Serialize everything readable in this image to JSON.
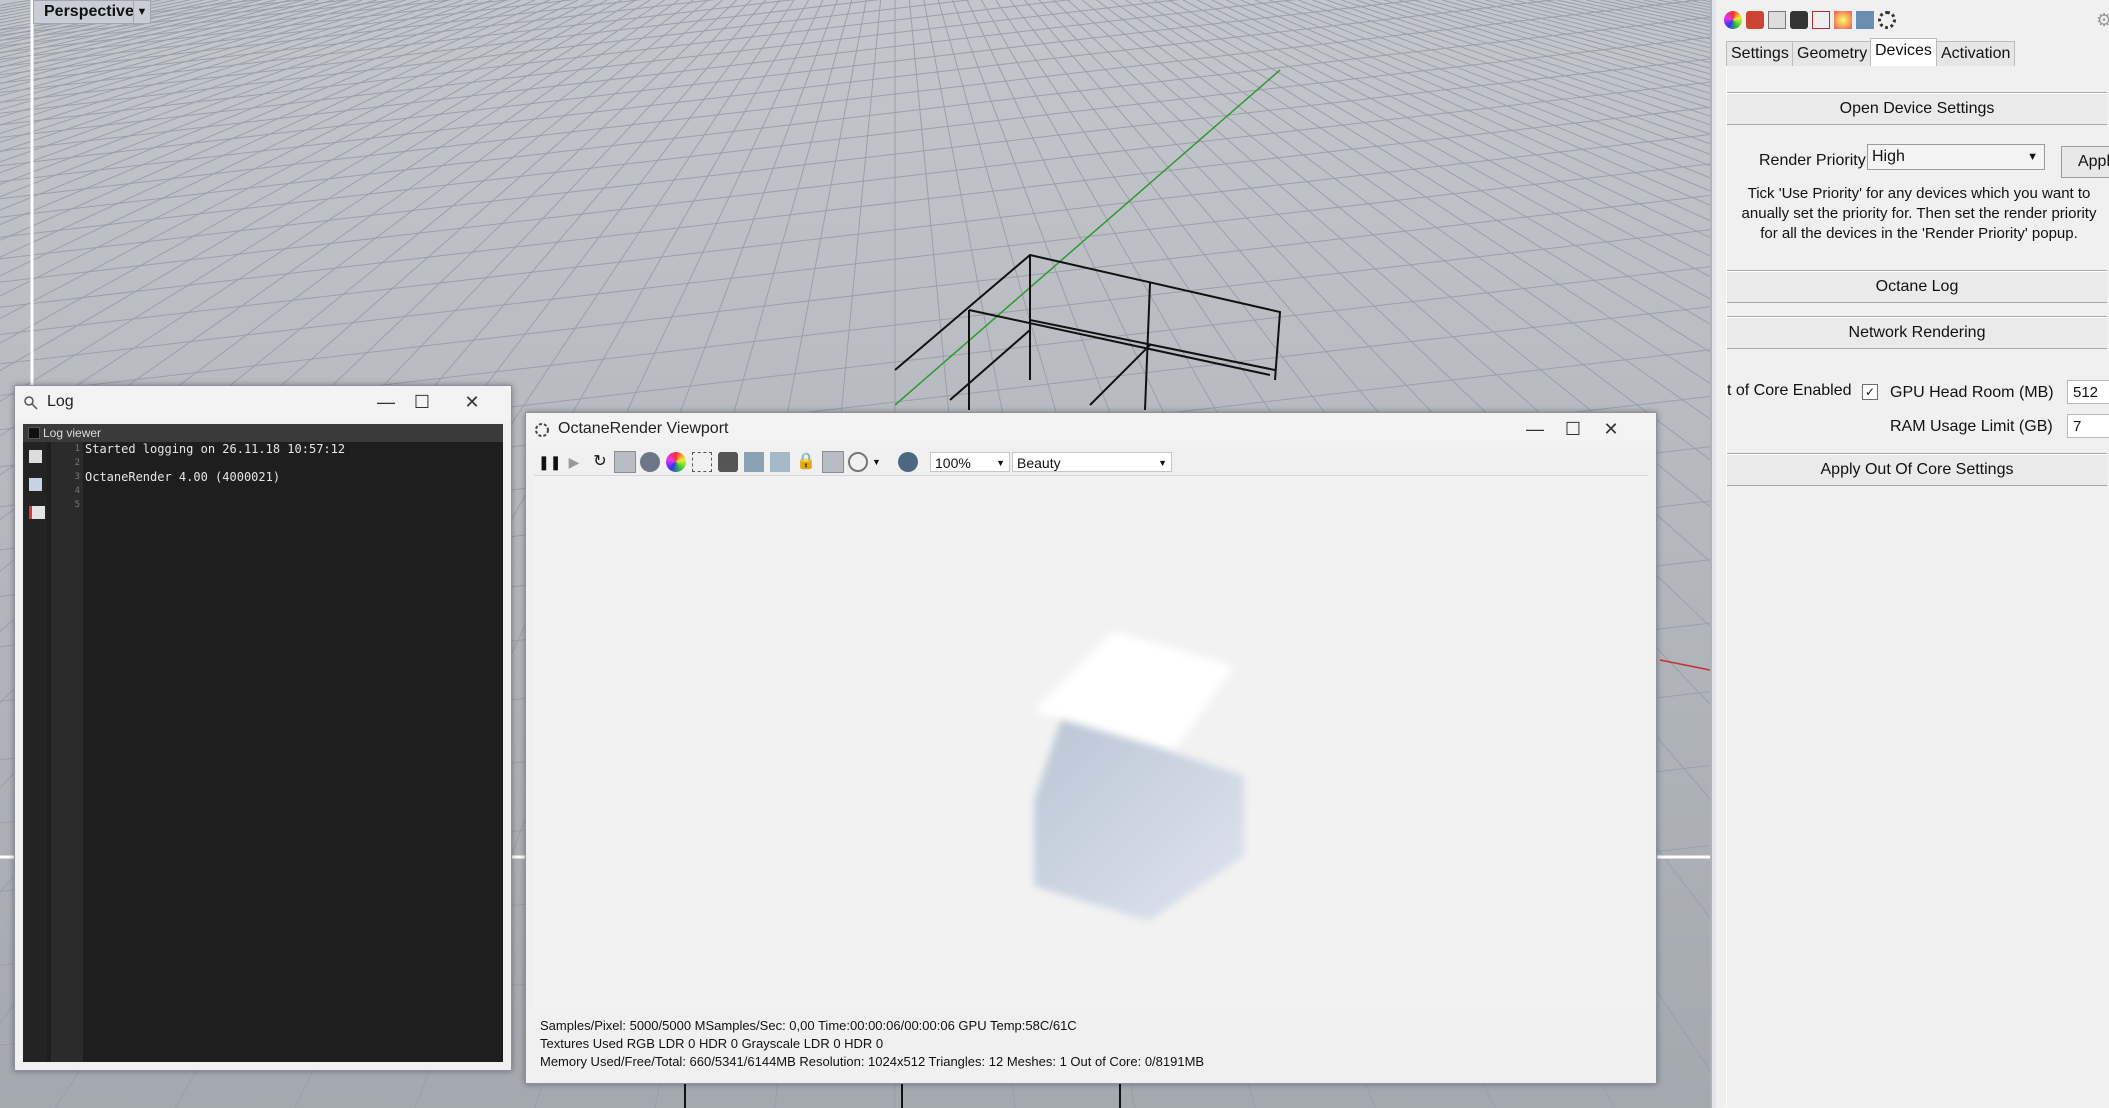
{
  "viewport": {
    "label": "Perspective",
    "dropdown_icon": "triangle-down-icon"
  },
  "log_window": {
    "title": "Log",
    "viewer_label": "Log viewer",
    "line_numbers": [
      "1",
      "2",
      "3",
      "4",
      "5"
    ],
    "lines": [
      "Started logging on 26.11.18 10:57:12",
      "",
      "OctaneRender 4.00 (4000021)",
      "",
      ""
    ],
    "tool_icons": [
      "save-icon",
      "copy-icon",
      "clear-icon"
    ]
  },
  "octane_window": {
    "title": "OctaneRender Viewport",
    "zoom": "100%",
    "pass": "Beauty",
    "toolbar_icons": [
      "pause-icon",
      "play-icon",
      "restart-icon",
      "autofocus-icon",
      "camera-sphere-icon",
      "color-sphere-icon",
      "region-icon",
      "snapshot-icon",
      "film-region-icon",
      "viewport-lock-icon",
      "lock-icon",
      "grid-icon",
      "picker-icon",
      "zoom-icon"
    ],
    "status": {
      "line1": "Samples/Pixel: 5000/5000  MSamples/Sec: 0,00  Time:00:00:06/00:00:06  GPU Temp:58C/61C",
      "line2": "Textures Used RGB LDR 0  HDR 0  Grayscale LDR 0  HDR 0",
      "line3": "Memory Used/Free/Total: 660/5341/6144MB  Resolution:  1024x512  Triangles:  12  Meshes:  1 Out of Core: 0/8191MB"
    }
  },
  "right_panel": {
    "top_icons": [
      "color-wheel-icon",
      "material-icon",
      "edit-icon",
      "camera-icon",
      "book-icon",
      "sun-icon",
      "devices-icon",
      "octane-icon",
      "gear-icon"
    ],
    "tabs": [
      "Settings",
      "Geometry",
      "Devices",
      "Activation"
    ],
    "active_tab": "Devices",
    "open_device_settings": "Open Device Settings",
    "render_priority_label": "Render Priority:",
    "render_priority_value": "High",
    "apply": "Apply",
    "info_lines": [
      "Tick 'Use Priority' for any devices which you want to",
      "anually set the priority for.  Then set the render priority",
      "for all the devices in the 'Render Priority' popup."
    ],
    "octane_log": "Octane Log",
    "network_rendering": "Network Rendering",
    "out_of_core_label": "t of Core Enabled",
    "out_of_core_checked": true,
    "gpu_headroom_label": "GPU Head Room (MB)",
    "gpu_headroom_value": "512",
    "ram_limit_label": "RAM Usage Limit (GB)",
    "ram_limit_value": "7",
    "apply_out_of_core": "Apply Out Of Core Settings"
  }
}
